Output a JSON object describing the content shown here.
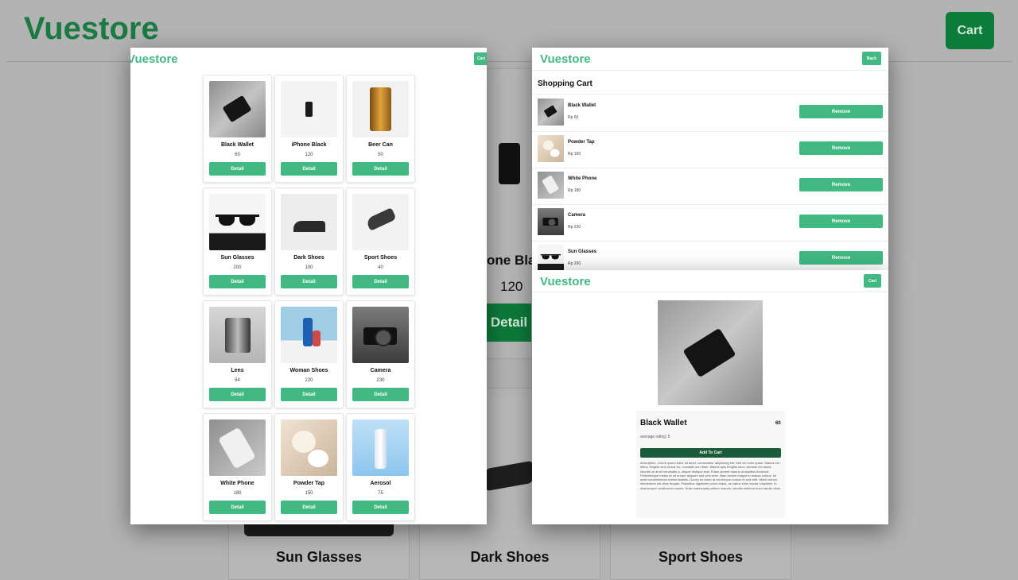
{
  "background": {
    "logo": "Vuestore",
    "cart_label": "Cart",
    "partial_product_name": "one Bla",
    "partial_product_price": "120",
    "detail_label": "Detail",
    "bottom_names": [
      "Sun Glasses",
      "Dark Shoes",
      "Sport Shoes"
    ]
  },
  "list_panel": {
    "logo": "Vuestore",
    "cart_label": "Cart",
    "detail_label": "Detail",
    "products": [
      {
        "name": "Black Wallet",
        "price": "60",
        "icon": "wallet"
      },
      {
        "name": "iPhone Black",
        "price": "120",
        "icon": "phone"
      },
      {
        "name": "Beer Can",
        "price": "50",
        "icon": "can"
      },
      {
        "name": "Sun Glasses",
        "price": "200",
        "icon": "sunglasses"
      },
      {
        "name": "Dark Shoes",
        "price": "100",
        "icon": "shoe-dark"
      },
      {
        "name": "Sport Shoes",
        "price": "40",
        "icon": "shoe-sport"
      },
      {
        "name": "Lens",
        "price": "84",
        "icon": "lens"
      },
      {
        "name": "Woman Shoes",
        "price": "220",
        "icon": "heels"
      },
      {
        "name": "Camera",
        "price": "230",
        "icon": "camera"
      },
      {
        "name": "White Phone",
        "price": "180",
        "icon": "phone-white"
      },
      {
        "name": "Powder Tap",
        "price": "150",
        "icon": "powder"
      },
      {
        "name": "Aerosol",
        "price": "75",
        "icon": "aerosol"
      }
    ]
  },
  "cart_panel": {
    "logo": "Vuestore",
    "back_label": "Back",
    "title": "Shopping Cart",
    "remove_label": "Remove",
    "items": [
      {
        "name": "Black Wallet",
        "price": "Rp 60"
      },
      {
        "name": "Powder Tap",
        "price": "Rp 150"
      },
      {
        "name": "White Phone",
        "price": "Rp 180"
      },
      {
        "name": "Camera",
        "price": "Rp 230"
      },
      {
        "name": "Sun Glasses",
        "price": "Rp 200"
      }
    ]
  },
  "detail_panel": {
    "logo": "Vuestore",
    "cart_label": "Cart",
    "product_name": "Black Wallet",
    "price": "60",
    "rating": "average rating: 5",
    "add_label": "Add To Cart",
    "description": "description: Lorem ipsum dolor sit amet, consectetur adipiscing elit. Sed vel enim quam. Mauris est tellus, fringilla sed cursus eu, convallis non diam. Mauris quis fringilla nunc. Aenean leo lacus, lobortis sit amet venenatis a, aliquet tristique erat. Etiam laoreet mauris at dapibus tincidunt. Pellentesque metus at mi ornare aliquam sed sem ante. Nam ornare magna in massa cursus, sit amet condimentum metus facilisis. Donec eu tortor at est tempor cursus et sed velit. Morbi rutrum elementum est vitae feugiat. Phasellus dignissim purus turpis, ac varius enim auctor vulputate. In ullamcorper vestibulum mauris. Nulla malesuada pretium mauris, lobortis eleifend dolor iaculis vitae."
  }
}
